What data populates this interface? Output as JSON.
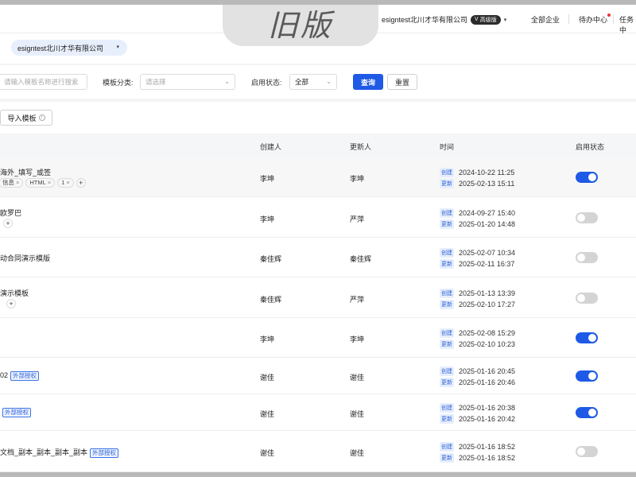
{
  "header": {
    "old_version_label": "旧版",
    "company_name": "esigntest北川才华有限公司",
    "edition_badge": "高级版",
    "nav": [
      "全部企业",
      "待办中心",
      "任务中"
    ]
  },
  "company_select": {
    "value": "esigntest北川才华有限公司"
  },
  "filters": {
    "search_placeholder": "请输入模板名称进行搜索",
    "category_label": "模板分类:",
    "category_placeholder": "请选择",
    "status_label": "启用状态:",
    "status_value": "全部",
    "query_button": "查询",
    "reset_button": "重置"
  },
  "import_button": "导入模板",
  "table": {
    "columns": [
      "创建人",
      "更新人",
      "时间",
      "启用状态"
    ],
    "create_badge": "创建",
    "update_badge": "更新",
    "external_tag": "外部授权",
    "rows": [
      {
        "name": "海外_填写_或签",
        "tags": [
          "信息",
          "HTML",
          "1"
        ],
        "creator": "李坤",
        "updater": "李坤",
        "created": "2024-10-22 11:25",
        "updated": "2025-02-13 15:11",
        "enabled": true
      },
      {
        "name": "欧罗巴",
        "tags": [],
        "creator": "李坤",
        "updater": "严萍",
        "created": "2024-09-27 15:40",
        "updated": "2025-01-20 14:48",
        "enabled": false
      },
      {
        "name": "动合同演示模版",
        "tags": [],
        "creator": "秦佳辉",
        "updater": "秦佳辉",
        "created": "2025-02-07 10:34",
        "updated": "2025-02-11 16:37",
        "enabled": false
      },
      {
        "name": "演示模板",
        "tags": [],
        "creator": "秦佳辉",
        "updater": "严萍",
        "created": "2025-01-13 13:39",
        "updated": "2025-02-10 17:27",
        "enabled": false
      },
      {
        "name": "",
        "tags": [],
        "creator": "李坤",
        "updater": "李坤",
        "created": "2025-02-08 15:29",
        "updated": "2025-02-10 10:23",
        "enabled": true
      },
      {
        "name": "02",
        "tags": [],
        "creator": "谢佳",
        "updater": "谢佳",
        "created": "2025-01-16 20:45",
        "updated": "2025-01-16 20:46",
        "enabled": true
      },
      {
        "name": "",
        "tags": [],
        "creator": "谢佳",
        "updater": "谢佳",
        "created": "2025-01-16 20:38",
        "updated": "2025-01-16 20:42",
        "enabled": true
      },
      {
        "name": "文档_副本_副本_副本_副本",
        "tags": [],
        "creator": "谢佳",
        "updater": "谢佳",
        "created": "2025-01-16 18:52",
        "updated": "2025-01-16 18:52",
        "enabled": false
      }
    ]
  }
}
